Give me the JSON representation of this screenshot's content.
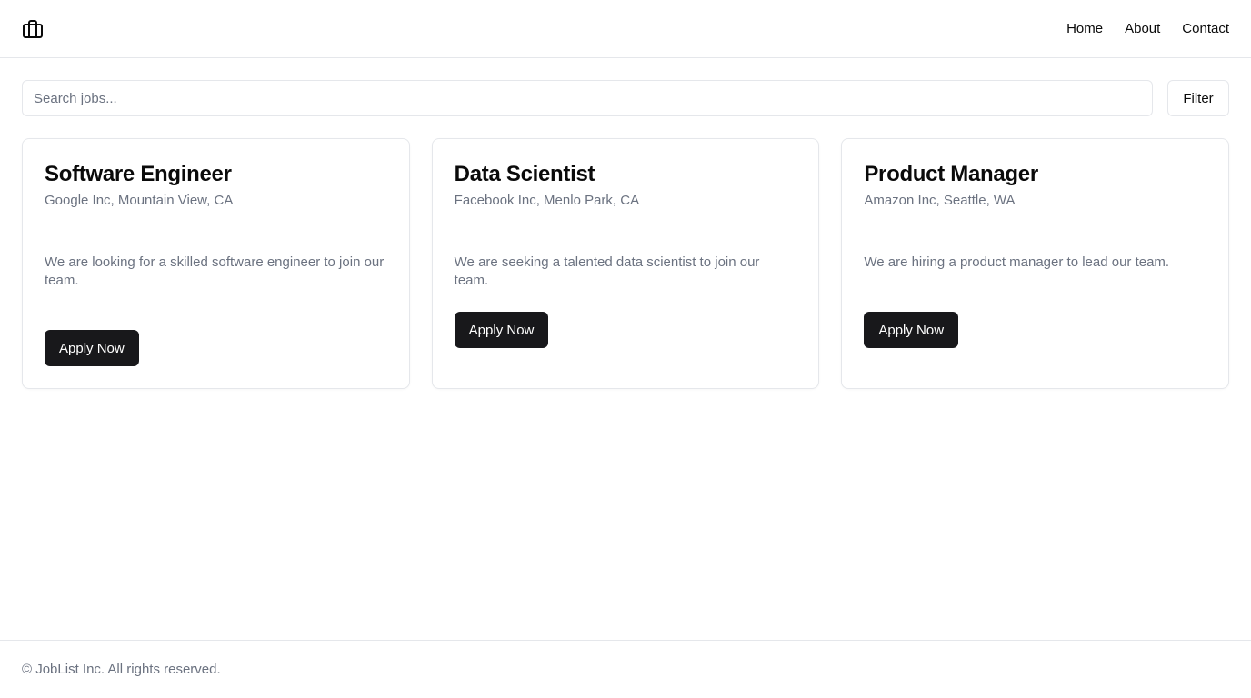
{
  "header": {
    "logo_icon": "briefcase-icon",
    "nav": [
      {
        "label": "Home"
      },
      {
        "label": "About"
      },
      {
        "label": "Contact"
      }
    ]
  },
  "search": {
    "placeholder": "Search jobs...",
    "value": "",
    "filter_label": "Filter"
  },
  "jobs": [
    {
      "title": "Software Engineer",
      "company": "Google Inc, Mountain View, CA",
      "description": "We are looking for a skilled software engineer to join our team.",
      "apply_label": "Apply Now"
    },
    {
      "title": "Data Scientist",
      "company": "Facebook Inc, Menlo Park, CA",
      "description": "We are seeking a talented data scientist to join our team.",
      "apply_label": "Apply Now"
    },
    {
      "title": "Product Manager",
      "company": "Amazon Inc, Seattle, WA",
      "description": "We are hiring a product manager to lead our team.",
      "apply_label": "Apply Now"
    }
  ],
  "footer": {
    "text": "© JobList Inc. All rights reserved."
  },
  "colors": {
    "primary_button": "#18181b",
    "muted_text": "#6b7280",
    "border": "#e5e7eb"
  }
}
